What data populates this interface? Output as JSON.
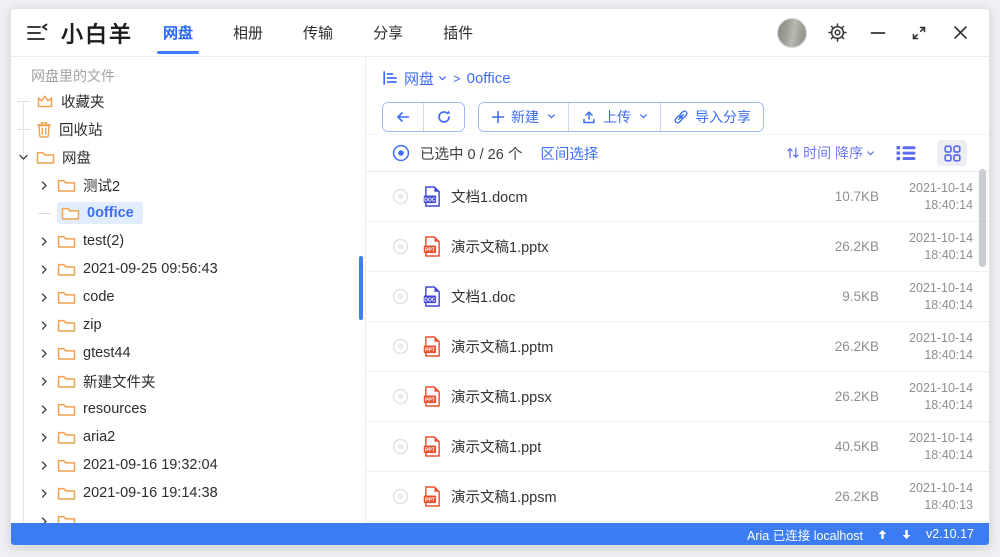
{
  "window": {
    "title": "小白羊",
    "tabs": [
      {
        "label": "网盘",
        "active": true
      },
      {
        "label": "相册"
      },
      {
        "label": "传输"
      },
      {
        "label": "分享"
      },
      {
        "label": "插件"
      }
    ]
  },
  "sidebar": {
    "header": "网盘里的文件",
    "top": [
      {
        "label": "收藏夹",
        "icon": "crown-icon"
      },
      {
        "label": "回收站",
        "icon": "trash-icon"
      },
      {
        "label": "网盘",
        "icon": "folder-icon",
        "expanded": true
      }
    ],
    "children": [
      {
        "label": "测试2"
      },
      {
        "label": "0office",
        "selected": true
      },
      {
        "label": "test(2)"
      },
      {
        "label": "2021-09-25 09:56:43"
      },
      {
        "label": "code"
      },
      {
        "label": "zip"
      },
      {
        "label": "gtest44"
      },
      {
        "label": "新建文件夹"
      },
      {
        "label": "resources"
      },
      {
        "label": "aria2"
      },
      {
        "label": "2021-09-16 19:32:04"
      },
      {
        "label": "2021-09-16 19:14:38"
      }
    ]
  },
  "main": {
    "breadcrumb": {
      "root": "网盘",
      "separator": ">",
      "current": "0office"
    },
    "toolbar": {
      "new": "新建",
      "upload": "上传",
      "import_share": "导入分享"
    },
    "selection": {
      "selected_text": "已选中 0 / 26 个",
      "range_select": "区间选择",
      "sort_label": "时间 降序"
    },
    "files": [
      {
        "name": "文档1.docm",
        "type": "doc",
        "badge": "DOC",
        "size": "10.7KB",
        "date": "2021-10-14",
        "time": "18:40:14"
      },
      {
        "name": "演示文稿1.pptx",
        "type": "ppt",
        "badge": "PPT",
        "size": "26.2KB",
        "date": "2021-10-14",
        "time": "18:40:14"
      },
      {
        "name": "文档1.doc",
        "type": "doc",
        "badge": "DOC",
        "size": "9.5KB",
        "date": "2021-10-14",
        "time": "18:40:14"
      },
      {
        "name": "演示文稿1.pptm",
        "type": "ppt",
        "badge": "PPT",
        "size": "26.2KB",
        "date": "2021-10-14",
        "time": "18:40:14"
      },
      {
        "name": "演示文稿1.ppsx",
        "type": "ppt",
        "badge": "PPT",
        "size": "26.2KB",
        "date": "2021-10-14",
        "time": "18:40:14"
      },
      {
        "name": "演示文稿1.ppt",
        "type": "ppt",
        "badge": "PPT",
        "size": "40.5KB",
        "date": "2021-10-14",
        "time": "18:40:14"
      },
      {
        "name": "演示文稿1.ppsm",
        "type": "ppt",
        "badge": "PPT",
        "size": "26.2KB",
        "date": "2021-10-14",
        "time": "18:40:13"
      }
    ]
  },
  "statusbar": {
    "aria_text": "Aria 已连接 localhost",
    "version": "v2.10.17"
  },
  "colors": {
    "accent_blue": "#3f6ef5",
    "active_tab": "#2a68f6",
    "folder_orange": "#f0a24e",
    "doc_icon": "#3f46d6",
    "ppt_icon": "#e8512e",
    "indigo_icons": "#5e6cf2",
    "statusbar_bg": "#3b7cf2",
    "selected_item_bg": "#e1ecff"
  }
}
